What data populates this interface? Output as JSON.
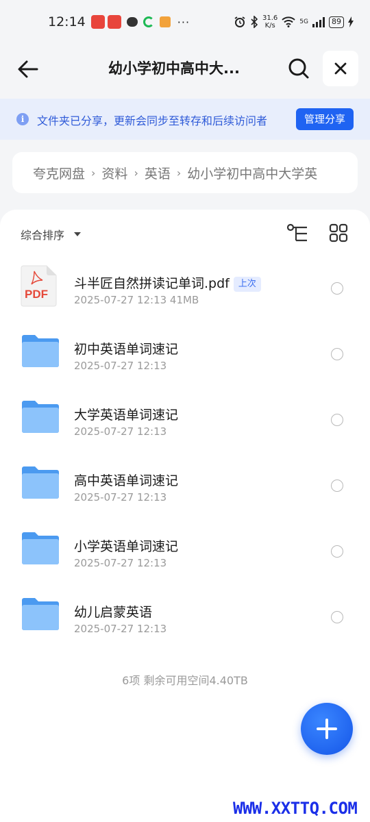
{
  "status_bar": {
    "time": "12:14",
    "dots": "···",
    "net_speed": "31.6",
    "net_unit": "K/s",
    "network": "5G",
    "battery": "89"
  },
  "header": {
    "title": "幼小学初中高中大...",
    "icons": {
      "back": "arrow-left-icon",
      "search": "search-icon",
      "close": "close-icon"
    }
  },
  "share_banner": {
    "text": "文件夹已分享，更新会同步至转存和后续访问者",
    "button": "管理分享",
    "colors": {
      "background": "#e8eefc",
      "text": "#2f5bd8",
      "button": "#1f63f2"
    }
  },
  "breadcrumb": {
    "items": [
      "夸克网盘",
      "资料",
      "英语",
      "幼小学初中高中大学英"
    ]
  },
  "toolbar": {
    "sort_label": "综合排序"
  },
  "files": [
    {
      "name": "斗半匠自然拼读记单词.pdf",
      "badge": "上次",
      "meta": "2025-07-27 12:13  41MB",
      "type": "pdf",
      "icon_label": "PDF"
    },
    {
      "name": "初中英语单词速记",
      "meta": "2025-07-27 12:13",
      "type": "folder"
    },
    {
      "name": "大学英语单词速记",
      "meta": "2025-07-27 12:13",
      "type": "folder"
    },
    {
      "name": "高中英语单词速记",
      "meta": "2025-07-27 12:13",
      "type": "folder"
    },
    {
      "name": "小学英语单词速记",
      "meta": "2025-07-27 12:13",
      "type": "folder"
    },
    {
      "name": "幼儿启蒙英语",
      "meta": "2025-07-27 12:13",
      "type": "folder"
    }
  ],
  "summary": "6项 剩余可用空间4.40TB",
  "watermark": "WWW.XXTTQ.COM",
  "colors": {
    "accent": "#1f63f2",
    "folder": "#5fa8f5",
    "pdf_red": "#e5493a"
  }
}
